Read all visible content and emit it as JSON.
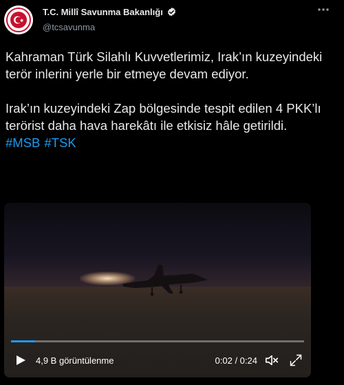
{
  "account": {
    "name": "T.C. Millî Savunma Bakanlığı",
    "handle": "@tcsavunma"
  },
  "tweet": {
    "paragraph1": "Kahraman Türk Silahlı Kuvvetlerimiz, Irak’ın kuzeyindeki terör inlerini yerle bir etmeye devam ediyor.",
    "paragraph2": "Irak’ın kuzeyindeki Zap bölgesinde tespit edilen 4 PKK’lı terörist daha hava harekâtı ile etkisiz hâle getirildi.",
    "hashtags": [
      "#MSB",
      "#TSK"
    ]
  },
  "video": {
    "views": "4,9 B görüntülenme",
    "time": "0:02 / 0:24",
    "progress": 0.083
  },
  "colors": {
    "accent": "#1d9bf0",
    "background": "#000000",
    "text": "#e7e9ea",
    "secondary": "#8b98a5"
  }
}
